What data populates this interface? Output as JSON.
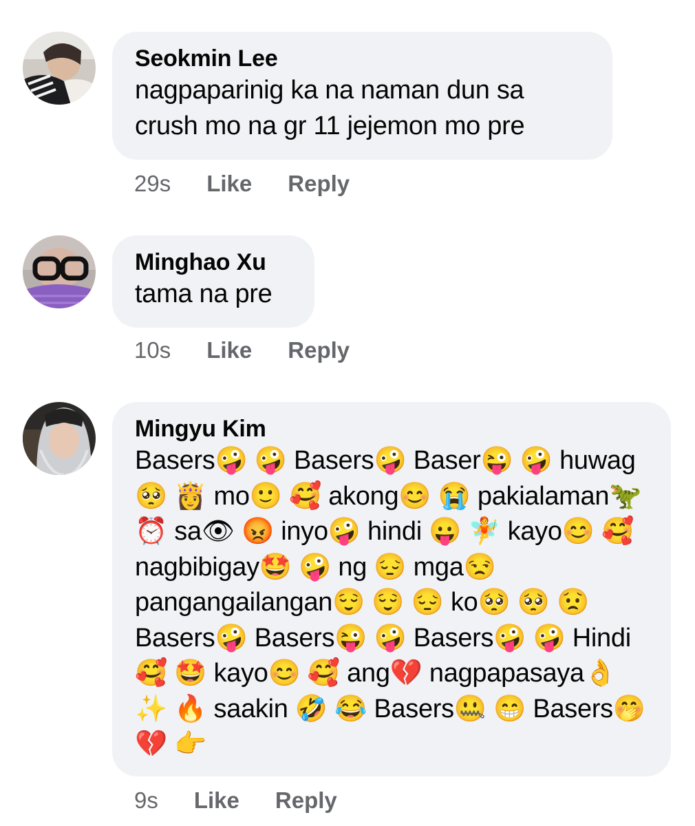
{
  "comments": [
    {
      "author": "Seokmin Lee",
      "text": "nagpaparinig ka na naman dun sa crush mo na gr 11 jejemon mo pre",
      "time": "29s",
      "like_label": "Like",
      "reply_label": "Reply"
    },
    {
      "author": "Minghao Xu",
      "text": "tama na pre",
      "time": "10s",
      "like_label": "Like",
      "reply_label": "Reply"
    },
    {
      "author": "Mingyu Kim",
      "text": "Basers🤪 🤪 Basers🤪 Baser😜 🤪 huwag🥺 👸 mo🙂 🥰 akong😊 😭 pakialaman🦖 ⏰ sa👁 😡 inyo🤪 hindi 😛 🧚 kayo😊 🥰 nagbibigay🤩 🤪 ng 😔 mga😒 pangangailangan😌 😌 😔 ko🥺 🥺 😟 Basers🤪 Basers😜 🤪 Basers🤪 🤪 Hindi🥰 🤩 kayo😊 🥰 ang💔 nagpapasaya👌 ✨ 🔥 saakin 🤣 😂 Basers🤐 😁 Basers🤭 💔 👉",
      "time": "9s",
      "like_label": "Like",
      "reply_label": "Reply"
    }
  ]
}
